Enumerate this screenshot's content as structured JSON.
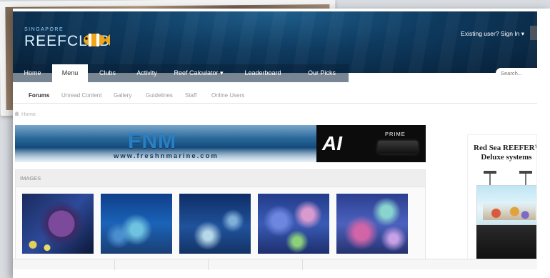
{
  "header": {
    "logo_small": "SINGAPORE",
    "logo_big": "REEFCLUB",
    "signin": "Existing user? Sign In ▾"
  },
  "nav": {
    "tabs": [
      {
        "label": "Home"
      },
      {
        "label": "Menu",
        "active": true
      },
      {
        "label": "Clubs"
      },
      {
        "label": "Activity"
      },
      {
        "label": "Reef Calculator ▾"
      },
      {
        "label": "Leaderboard"
      },
      {
        "label": "Our Picks"
      }
    ],
    "search_placeholder": "Search..."
  },
  "subnav": {
    "items": [
      "Forums",
      "Unread Content",
      "Gallery",
      "Guidelines",
      "Staff",
      "Online Users"
    ]
  },
  "breadcrumb": {
    "home": "Home"
  },
  "banners": {
    "fnm_logo": "FNM",
    "fnm_url": "www.freshnmarine.com",
    "ai_logo": "AI",
    "ai_product": "PRIME"
  },
  "images_section": {
    "title": "IMAGES"
  },
  "ad_right": {
    "title_line1": "Red Sea REEFER™",
    "title_line2": "Deluxe systems"
  },
  "colors": {
    "header_bg": "#0e3a5f",
    "active_tab": "#ffffff",
    "nav_text": "#ffffff"
  }
}
